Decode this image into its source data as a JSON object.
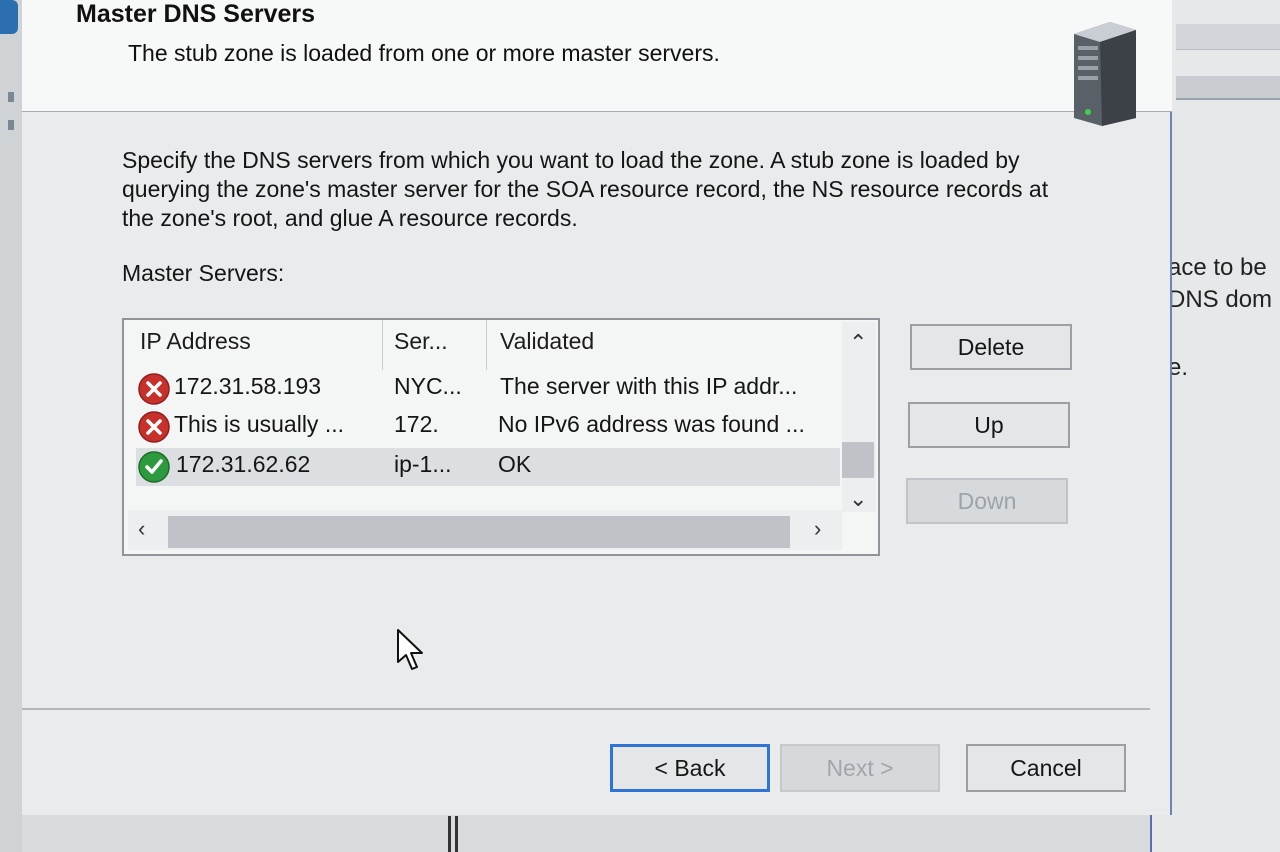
{
  "header": {
    "title": "Master DNS Servers",
    "subtitle": "The stub zone is loaded from one or more master servers."
  },
  "body": {
    "description": "Specify the DNS servers from which you want to load the zone. A stub zone is loaded by querying the zone's master server for the SOA resource record, the NS resource records at the zone's root, and glue A resource records.",
    "list_label": "Master Servers:"
  },
  "list": {
    "columns": [
      "IP Address",
      "Ser...",
      "Validated"
    ],
    "rows": [
      {
        "status": "error-icon",
        "ip": "172.31.58.193",
        "server": "NYC...",
        "validated": "The server with this IP addr..."
      },
      {
        "status": "error-icon",
        "ip": "This is usually ...",
        "server": "172.",
        "validated": "No IPv6 address was found ..."
      },
      {
        "status": "ok-icon",
        "ip": "172.31.62.62",
        "server": "ip-1...",
        "validated": "OK"
      }
    ]
  },
  "side_buttons": {
    "delete": "Delete",
    "up": "Up",
    "down": "Down"
  },
  "footer": {
    "back": "< Back",
    "next": "Next >",
    "cancel": "Cancel"
  },
  "background_window": {
    "line1": "ace to be",
    "line2": "DNS dom",
    "line3": "e."
  },
  "colors": {
    "accent": "#2e74d6",
    "error": "#c8302c",
    "ok": "#2e9a3e"
  }
}
